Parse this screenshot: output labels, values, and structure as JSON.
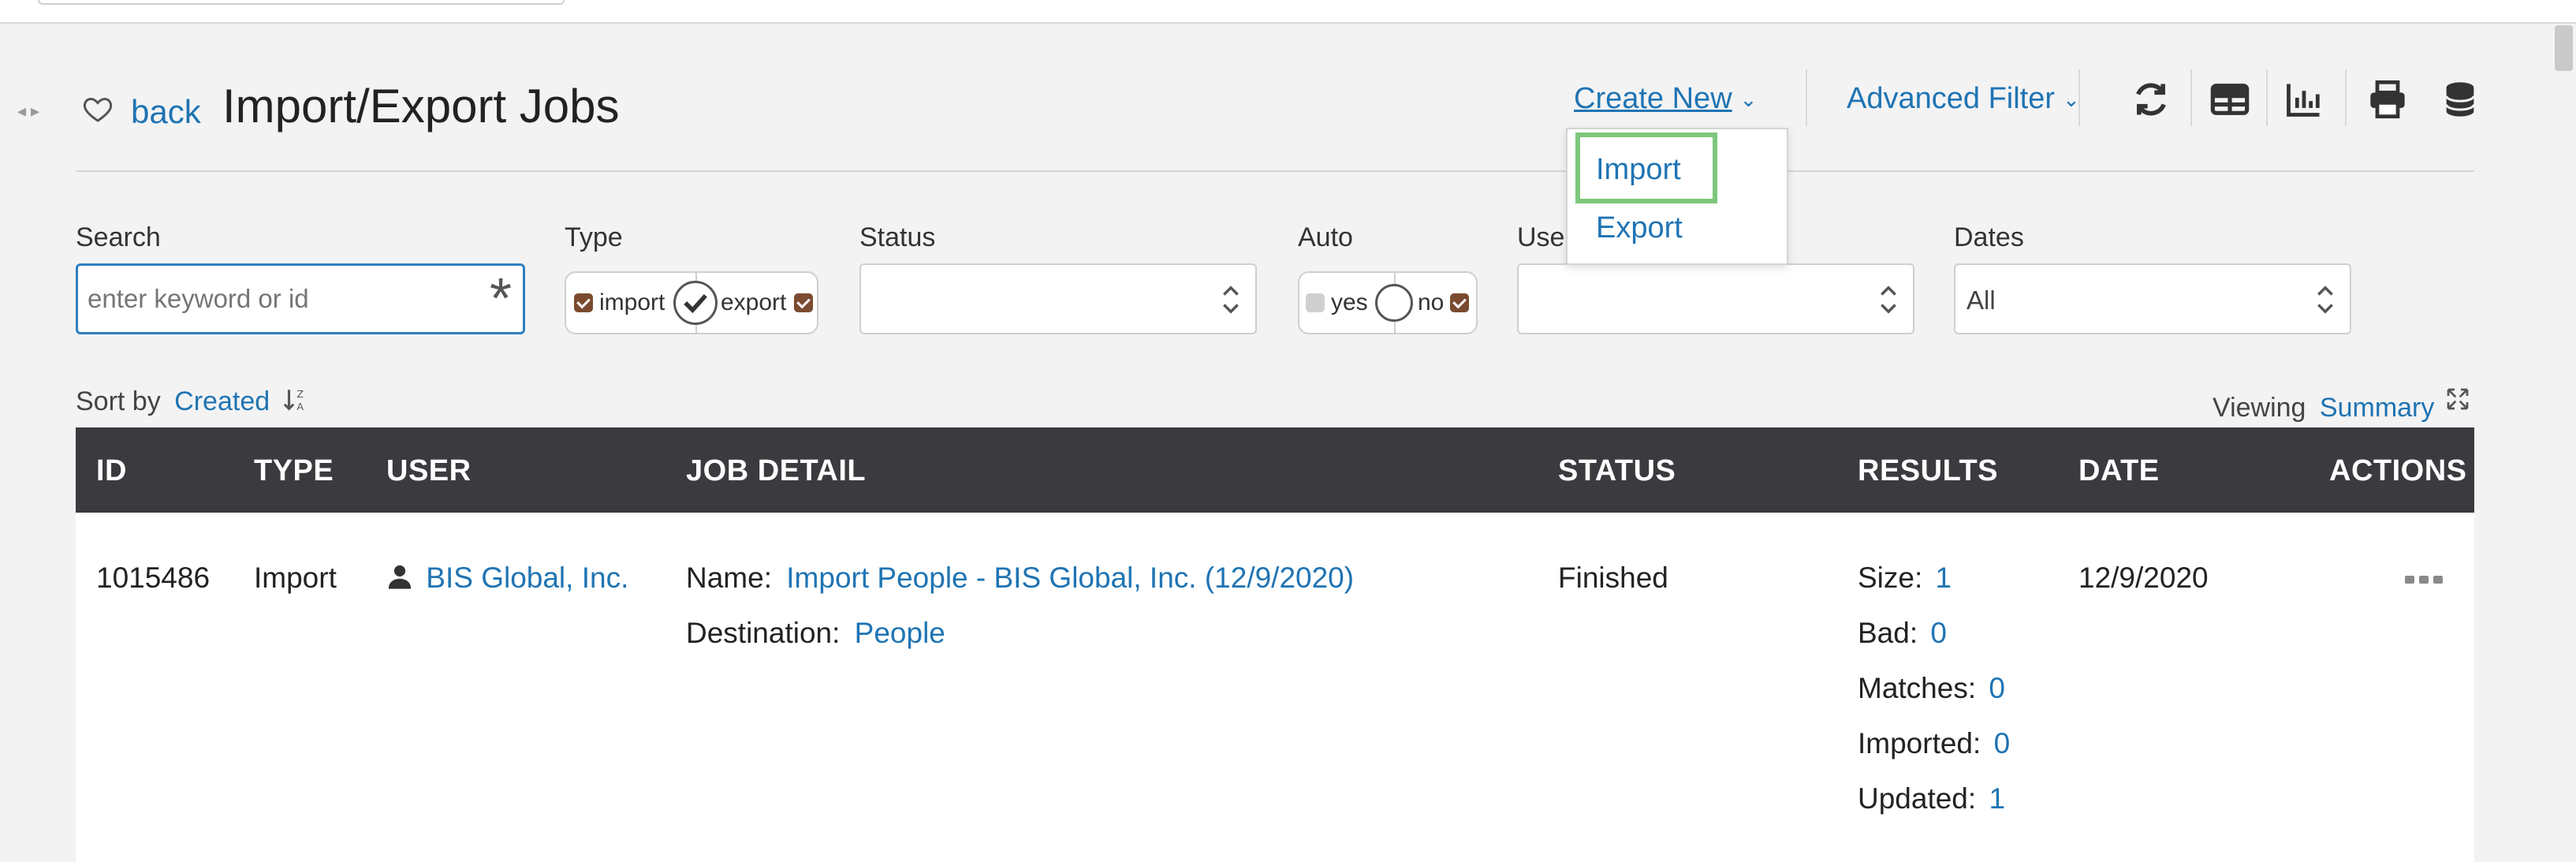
{
  "header": {
    "back_label": "back",
    "title": "Import/Export Jobs",
    "create_new_label": "Create New",
    "advanced_filter_label": "Advanced Filter",
    "toolbar_icons": [
      "refresh-icon",
      "table-view-icon",
      "chart-icon",
      "print-icon",
      "database-icon"
    ]
  },
  "create_menu": {
    "items": [
      "Import",
      "Export"
    ],
    "highlighted": "Import",
    "highlight_color": "#7dc77d"
  },
  "filters": {
    "search": {
      "label": "Search",
      "placeholder": "enter keyword or id"
    },
    "type": {
      "label": "Type",
      "options": [
        "import",
        "export"
      ]
    },
    "status": {
      "label": "Status",
      "value": ""
    },
    "auto": {
      "label": "Auto",
      "options": [
        "yes",
        "no"
      ]
    },
    "user": {
      "label": "Use",
      "value": ""
    },
    "dates": {
      "label": "Dates",
      "value": "All"
    }
  },
  "sort": {
    "prefix": "Sort by",
    "field": "Created"
  },
  "viewing": {
    "prefix": "Viewing",
    "mode": "Summary"
  },
  "table": {
    "columns": [
      "ID",
      "TYPE",
      "USER",
      "JOB DETAIL",
      "STATUS",
      "RESULTS",
      "DATE",
      "ACTIONS"
    ],
    "rows": [
      {
        "id": "1015486",
        "type": "Import",
        "user": "BIS Global, Inc.",
        "name_label": "Name:",
        "name": "Import People - BIS Global, Inc. (12/9/2020)",
        "destination_label": "Destination:",
        "destination": "People",
        "status": "Finished",
        "results": [
          {
            "label": "Size:",
            "value": "1"
          },
          {
            "label": "Bad:",
            "value": "0"
          },
          {
            "label": "Matches:",
            "value": "0"
          },
          {
            "label": "Imported:",
            "value": "0"
          },
          {
            "label": "Updated:",
            "value": "1"
          }
        ],
        "date": "12/9/2020"
      }
    ]
  },
  "colors": {
    "link": "#1f74b3",
    "table_header": "#3a3a3f",
    "checkbox_on": "#7a4b2e"
  }
}
